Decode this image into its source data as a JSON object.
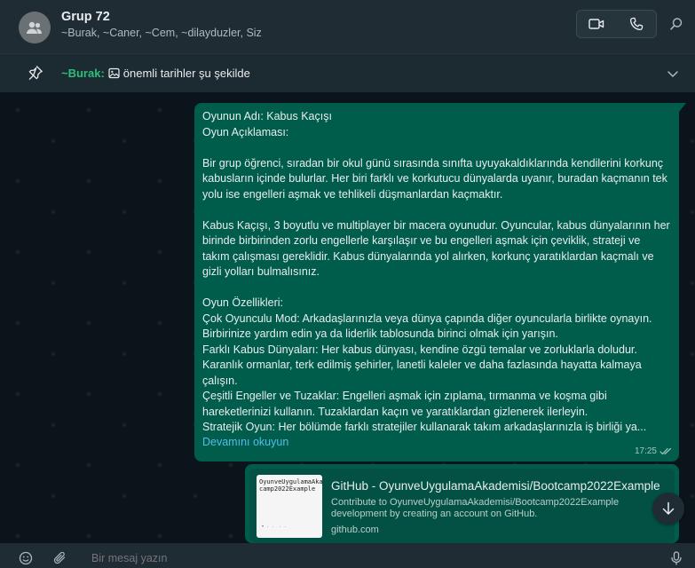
{
  "header": {
    "title": "Grup 72",
    "members": "~Burak, ~Caner, ~Cem, ~dilayduzler, Siz"
  },
  "pinned": {
    "author": "~Burak:",
    "text": "önemli tarihler şu şekilde"
  },
  "message": {
    "text": "Oyunun Adı: Kabus Kaçışı\nOyun Açıklaması:\n\nBir grup öğrenci, sıradan bir okul günü sırasında sınıfta uyuyakaldıklarında kendilerini korkunç kabusların içinde bulurlar. Her biri farklı ve korkutucu dünyalarda uyanır, buradan kaçmanın tek yolu ise engelleri aşmak ve tehlikeli düşmanlardan kaçmaktır.\n\nKabus Kaçışı, 3 boyutlu ve multiplayer bir macera oyunudur. Oyuncular, kabus dünyalarının her birinde birbirinden zorlu engellerle karşılaşır ve bu engelleri aşmak için çeviklik, strateji ve takım çalışması gereklidir. Kabus dünyalarında yol alırken, korkunç yaratıklardan kaçmalı ve gizli yolları bulmalısınız.\n\nOyun Özellikleri:\nÇok Oyunculu Mod: Arkadaşlarınızla veya dünya çapında diğer oyuncularla birlikte oynayın. Birbirinize yardım edin ya da liderlik tablosunda birinci olmak için yarışın.\nFarklı Kabus Dünyaları: Her kabus dünyası, kendine özgü temalar ve zorluklarla doludur. Karanlık ormanlar, terk edilmiş şehirler, lanetli kaleler ve daha fazlasında hayatta kalmaya çalışın.\nÇeşitli Engeller ve Tuzaklar: Engelleri aşmak için zıplama, tırmanma ve koşma gibi hareketlerinizi kullanın. Tuzaklardan kaçın ve yaratıklardan gizlenerek ilerleyin.\nStratejik Oyun: Her bölümde farklı stratejiler kullanarak takım arkadaşlarınızla iş birliği ya...",
    "read_more": "Devamını okuyun",
    "time": "17:25"
  },
  "link_preview": {
    "title": "GitHub - OyunveUygulamaAkademisi/Bootcamp2022Example",
    "description": "Contribute to OyunveUygulamaAkademisi/Bootcamp2022Example development by creating an account on GitHub.",
    "host": "github.com",
    "thumb_text": "OyunveUygulamaAkademi\ncamp2022Example"
  },
  "composer": {
    "placeholder": "Bir mesaj yazın"
  },
  "colors": {
    "outgoing_bubble": "#005c4b",
    "header_bg": "#1f2c34",
    "chat_bg": "#0b141a",
    "link": "#53bdeb",
    "pin_author": "#2bbf7a"
  },
  "icons": {
    "avatar": "group-avatar-icon",
    "video": "video-call-icon",
    "voice": "voice-call-icon",
    "search": "search-icon",
    "pin": "pin-icon",
    "image": "image-icon",
    "chevron": "chevron-down-icon",
    "emoji": "emoji-icon",
    "attach": "attach-icon",
    "mic": "mic-icon",
    "scroll_down": "arrow-down-icon",
    "read": "double-check-icon"
  }
}
